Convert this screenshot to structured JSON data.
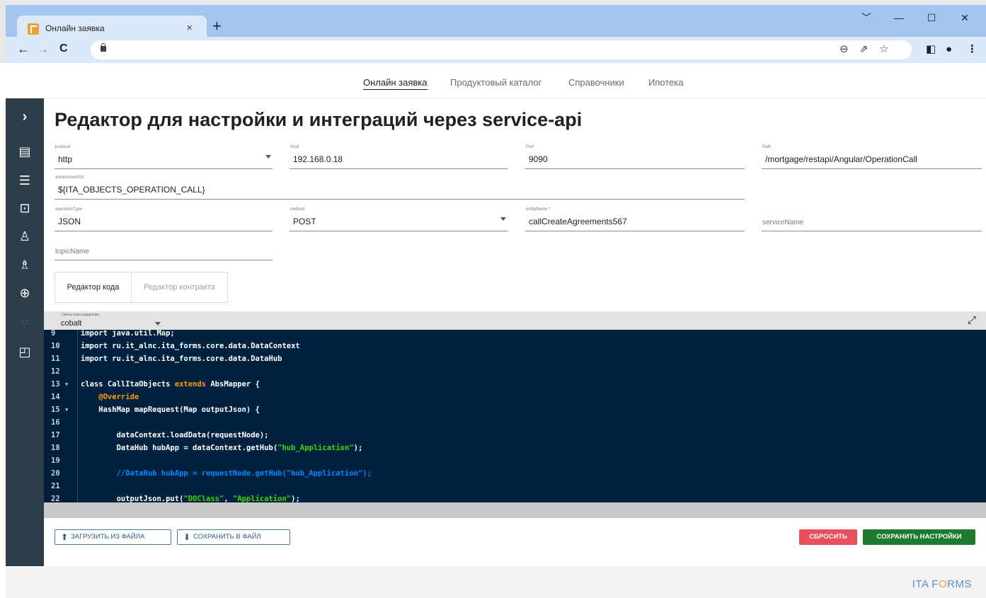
{
  "browser": {
    "tab_title": "Онлайн заявка",
    "tab_close": "×",
    "new_tab": "+",
    "window_controls": [
      "﹀",
      "—",
      "☐",
      "✕"
    ],
    "nav": {
      "back": "←",
      "forward": "→",
      "reload": "C"
    },
    "address_text": ""
  },
  "topnav": {
    "items": [
      "Онлайн заявка",
      "Продуктовый каталог",
      "Справочники",
      "Ипотека"
    ],
    "active_index": 0
  },
  "sidebar": {
    "icons": [
      "chevron-right-icon",
      "document-icon",
      "list-icon",
      "briefcase-icon",
      "user-icon",
      "users-icon",
      "lock-icon",
      "lightbulb-icon",
      "file-icon"
    ]
  },
  "page": {
    "title": "Редактор для настройки и интеграций через service-api"
  },
  "form": {
    "protocol": {
      "label": "protocol",
      "value": "http"
    },
    "host": {
      "label": "Host",
      "value": "192.168.0.18"
    },
    "port": {
      "label": "Port",
      "value": "9090"
    },
    "path": {
      "label": "Path",
      "value": "/mortgage/restapi/Angular/OperationCall"
    },
    "environmentUrl": {
      "label": "environmentUrl",
      "value": "${ITA_OBJECTS_OPERATION_CALL}"
    },
    "operationType": {
      "label": "operationType",
      "value": "JSON"
    },
    "method": {
      "label": "method",
      "value": "POST"
    },
    "entityName": {
      "label": "entityName *",
      "value": "callCreateAgreements567"
    },
    "serviceName": {
      "placeholder": "serviceName"
    },
    "topicName": {
      "placeholder": "topicName"
    }
  },
  "editor_tabs": {
    "code": "Редактор кода",
    "contract": "Редактор контракта"
  },
  "theme": {
    "label": "Смена темы редактора",
    "value": "cobalt"
  },
  "code_lines": [
    {
      "n": "9",
      "fold": false
    },
    {
      "n": "10",
      "fold": false
    },
    {
      "n": "11",
      "fold": false
    },
    {
      "n": "12",
      "fold": false
    },
    {
      "n": "13",
      "fold": true
    },
    {
      "n": "14",
      "fold": false
    },
    {
      "n": "15",
      "fold": true
    },
    {
      "n": "16",
      "fold": false
    },
    {
      "n": "17",
      "fold": false
    },
    {
      "n": "18",
      "fold": false
    },
    {
      "n": "19",
      "fold": false
    },
    {
      "n": "20",
      "fold": false
    },
    {
      "n": "21",
      "fold": false
    },
    {
      "n": "22",
      "fold": false
    }
  ],
  "code": {
    "l9": "import java.util.Map;",
    "l10": "import ru.it_alnc.ita_forms.core.data.DataContext",
    "l11": "import ru.it_alnc.ita_forms.core.data.DataHub",
    "l13_a": "class CallItaObjects ",
    "l13_kw": "extends",
    "l13_b": " AbsMapper {",
    "l14": "    @Override",
    "l15": "    HashMap mapRequest(Map outputJson) {",
    "l17": "        dataContext.loadData(requestNode);",
    "l18_a": "        DataHub hubApp = dataContext.getHub(",
    "l18_str": "\"hub_Application\"",
    "l18_b": ");",
    "l20": "        //DataHub hubApp = requestNode.getHub(\"hub_Application\");",
    "l22_a": "        outputJson.put(",
    "l22_str1": "\"DOClass\"",
    "l22_b": ", ",
    "l22_str2": "\"Application\"",
    "l22_c": ");"
  },
  "buttons": {
    "upload": "ЗАГРУЗИТЬ ИЗ ФАЙЛА",
    "download": "СОХРАНИТЬ В ФАЙЛ",
    "reset": "СБРОСИТЬ",
    "save": "СОХРАНИТЬ НАСТРОЙКИ"
  },
  "footer": {
    "logo_a": "ITA F",
    "logo_o": "O",
    "logo_b": "RMS"
  },
  "colors": {
    "sidebar": "#2d3d4a",
    "editor_bg": "#002240",
    "keyword": "#ff9d00",
    "string": "#3ad900",
    "comment": "#0088ff",
    "reset": "#e8505b",
    "save": "#1e7a2e",
    "logo": "#5a8fc4"
  }
}
